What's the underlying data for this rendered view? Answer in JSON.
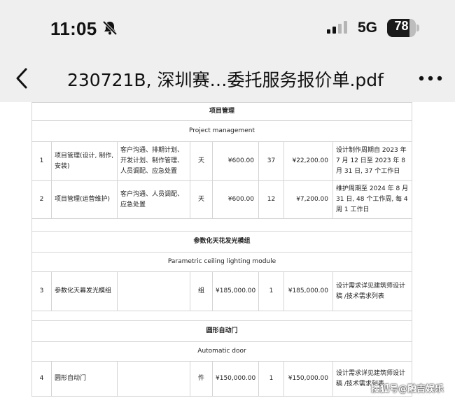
{
  "status_bar": {
    "time": "11:05",
    "network": "5G",
    "battery": "78",
    "battery_level": 0.78,
    "bell_icon": "bell-slash-icon",
    "signal_icon": "cellular-signal-icon"
  },
  "nav": {
    "back_icon": "chevron-left-icon",
    "title": "230721B, 深圳赛…委托服务报价单.pdf",
    "more_icon": "ellipsis-icon"
  },
  "sections": [
    {
      "title_cn": "项目管理",
      "title_en": "Project management",
      "rows": [
        {
          "no": "1",
          "name": "项目管理(设计, 制作, 安装)",
          "content": "客户沟通、排期计划、开发计划、制作管理、人员调配、应急处置",
          "unit": "天",
          "price": "¥600.00",
          "qty": "37",
          "total": "¥22,200.00",
          "note": "设计制作周期自 2023 年 7 月 12 日至 2023 年 8 月 31 日, 37 个工作日"
        },
        {
          "no": "2",
          "name": "项目管理(运营维护)",
          "content": "客户沟通、人员调配、应急处置",
          "unit": "天",
          "price": "¥600.00",
          "qty": "12",
          "total": "¥7,200.00",
          "note": "维护周期至 2024 年 8 月 31 日, 48 个工作周, 每 4 周 1 工作日"
        }
      ]
    },
    {
      "title_cn": "参数化天花发光模组",
      "title_en": "Parametric ceiling lighting module",
      "rows": [
        {
          "no": "3",
          "name": "参数化天幕发光模组",
          "content": "",
          "unit": "组",
          "price": "¥185,000.00",
          "qty": "1",
          "total": "¥185,000.00",
          "note": "设计需求详见建筑师设计稿 /技术需求列表"
        }
      ]
    },
    {
      "title_cn": "圆形自动门",
      "title_en": "Automatic door",
      "rows": [
        {
          "no": "4",
          "name": "圆形自动门",
          "content": "",
          "unit": "件",
          "price": "¥150,000.00",
          "qty": "1",
          "total": "¥150,000.00",
          "note": "设计需求详见建筑师设计稿 /技术需求列表"
        }
      ]
    }
  ],
  "watermark": "搜狐号@融吉娱乐"
}
